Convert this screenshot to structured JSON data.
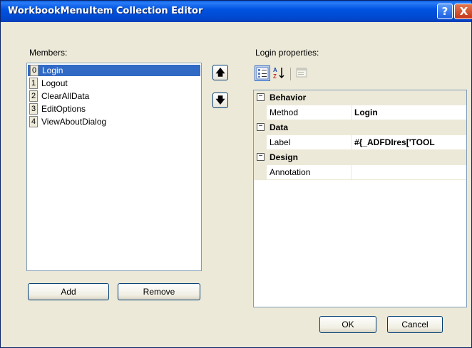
{
  "window": {
    "title": "WorkbookMenuItem Collection Editor",
    "help_label": "?",
    "close_label": "X"
  },
  "members": {
    "label": "Members:",
    "items": [
      {
        "index": "0",
        "name": "Login"
      },
      {
        "index": "1",
        "name": "Logout"
      },
      {
        "index": "2",
        "name": "ClearAllData"
      },
      {
        "index": "3",
        "name": "EditOptions"
      },
      {
        "index": "4",
        "name": "ViewAboutDialog"
      }
    ],
    "selected_index": 0,
    "add_label": "Add",
    "remove_label": "Remove",
    "move_up_glyph": "🡅",
    "move_down_glyph": "🡇"
  },
  "properties": {
    "label": "Login properties:",
    "toolbar": {
      "categorized_icon": "categorized-icon",
      "alphabetical_icon": "alphabetical-sort-icon",
      "pages_icon": "property-pages-icon"
    },
    "categories": [
      {
        "name": "Behavior",
        "expander": "⊟",
        "props": [
          {
            "name": "Method",
            "value": "Login"
          }
        ]
      },
      {
        "name": "Data",
        "expander": "⊟",
        "props": [
          {
            "name": "Label",
            "value": "#{_ADFDIres['TOOL"
          }
        ]
      },
      {
        "name": "Design",
        "expander": "⊟",
        "props": [
          {
            "name": "Annotation",
            "value": ""
          }
        ]
      }
    ]
  },
  "footer": {
    "ok_label": "OK",
    "cancel_label": "Cancel"
  },
  "colors": {
    "title_bar": "#0054e3",
    "selection": "#316ac5",
    "dialog_bg": "#ece9d8"
  }
}
